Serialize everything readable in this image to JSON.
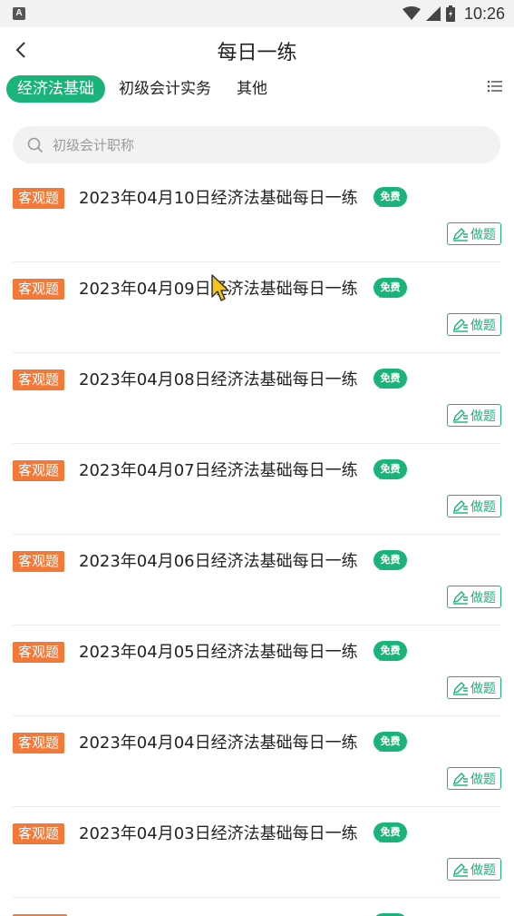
{
  "status_bar": {
    "time": "10:26",
    "app_icon_letter": "A"
  },
  "header": {
    "title": "每日一练"
  },
  "tabs": [
    {
      "label": "经济法基础",
      "active": true
    },
    {
      "label": "初级会计实务",
      "active": false
    },
    {
      "label": "其他",
      "active": false
    }
  ],
  "search": {
    "placeholder": "初级会计职称"
  },
  "items": [
    {
      "tag": "客观题",
      "title": "2023年04月10日经济法基础每日一练",
      "badge": "免费",
      "action": "做题"
    },
    {
      "tag": "客观题",
      "title": "2023年04月09日经济法基础每日一练",
      "badge": "免费",
      "action": "做题"
    },
    {
      "tag": "客观题",
      "title": "2023年04月08日经济法基础每日一练",
      "badge": "免费",
      "action": "做题"
    },
    {
      "tag": "客观题",
      "title": "2023年04月07日经济法基础每日一练",
      "badge": "免费",
      "action": "做题"
    },
    {
      "tag": "客观题",
      "title": "2023年04月06日经济法基础每日一练",
      "badge": "免费",
      "action": "做题"
    },
    {
      "tag": "客观题",
      "title": "2023年04月05日经济法基础每日一练",
      "badge": "免费",
      "action": "做题"
    },
    {
      "tag": "客观题",
      "title": "2023年04月04日经济法基础每日一练",
      "badge": "免费",
      "action": "做题"
    },
    {
      "tag": "客观题",
      "title": "2023年04月03日经济法基础每日一练",
      "badge": "免费",
      "action": "做题"
    }
  ],
  "colors": {
    "accent_green": "#1ab37a",
    "tag_orange": "#f47938"
  },
  "icons": [
    "back-arrow-icon",
    "list-menu-icon",
    "search-icon",
    "edit-icon",
    "wifi-icon",
    "signal-icon",
    "battery-icon"
  ]
}
